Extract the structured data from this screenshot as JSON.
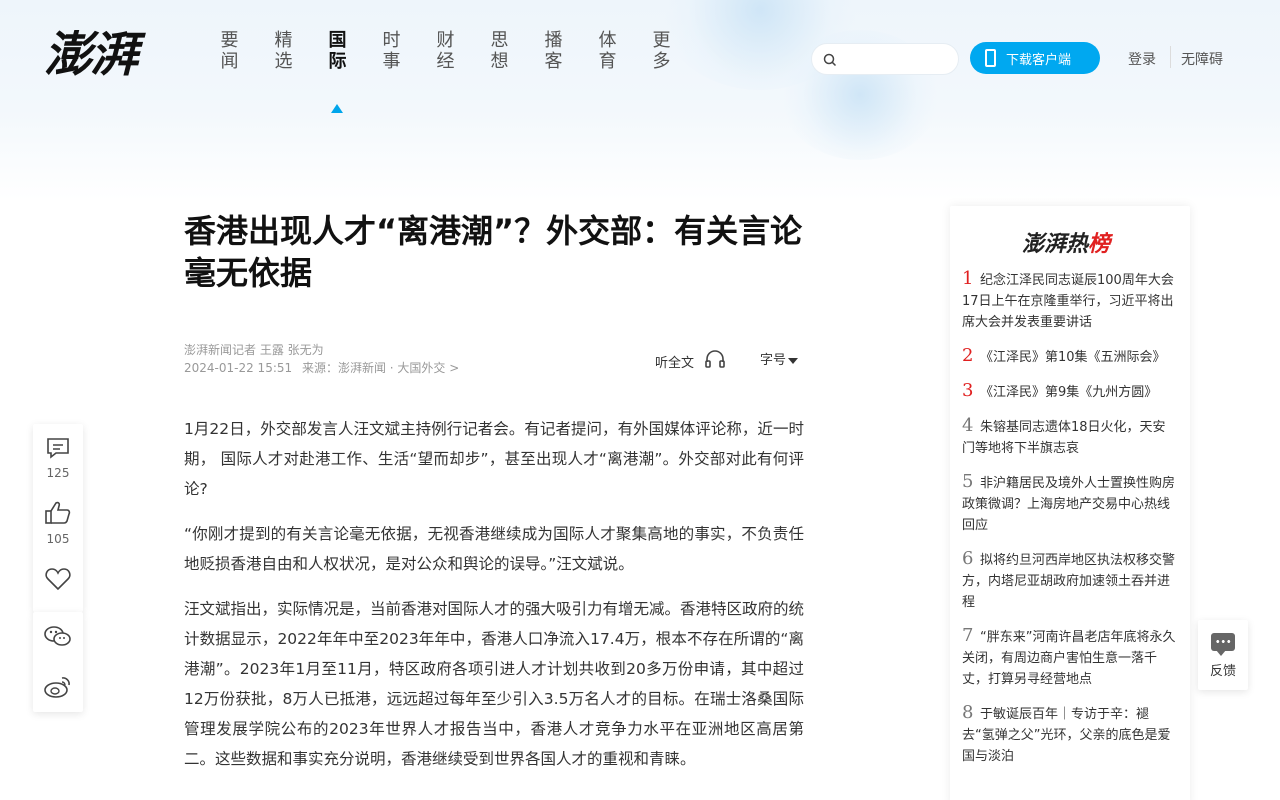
{
  "header": {
    "logo": "澎湃",
    "nav": [
      {
        "top": "要",
        "bottom": "闻",
        "active": false
      },
      {
        "top": "精",
        "bottom": "选",
        "active": false
      },
      {
        "top": "国",
        "bottom": "际",
        "active": true
      },
      {
        "top": "时",
        "bottom": "事",
        "active": false
      },
      {
        "top": "财",
        "bottom": "经",
        "active": false
      },
      {
        "top": "思",
        "bottom": "想",
        "active": false
      },
      {
        "top": "播",
        "bottom": "客",
        "active": false
      },
      {
        "top": "体",
        "bottom": "育",
        "active": false
      },
      {
        "top": "更",
        "bottom": "多",
        "active": false
      }
    ],
    "search_placeholder": "",
    "download_label": "下载客户端",
    "login_label": "登录",
    "accessibility_label": "无障碍"
  },
  "article": {
    "title": "香港出现人才“离港潮”？外交部：有关言论毫无依据",
    "authors": "澎湃新闻记者 王露 张无为",
    "datetime": "2024-01-22 15:51",
    "source_prefix": "来源：",
    "source": "澎湃新闻 · 大国外交 >",
    "listen_label": "听全文",
    "fontsize_label": "字号",
    "paragraphs": [
      "1月22日，外交部发言人汪文斌主持例行记者会。有记者提问，有外国媒体评论称，近一时期， 国际人才对赴港工作、生活“望而却步”，甚至出现人才“离港潮”。外交部对此有何评论?",
      "“你刚才提到的有关言论毫无依据，无视香港继续成为国际人才聚集高地的事实，不负责任地贬损香港自由和人权状况，是对公众和舆论的误导。”汪文斌说。",
      "汪文斌指出，实际情况是，当前香港对国际人才的强大吸引力有增无减。香港特区政府的统计数据显示，2022年年中至2023年年中，香港人口净流入17.4万，根本不存在所谓的“离港潮”。2023年1月至11月，特区政府各项引进人才计划共收到20多万份申请，其中超过12万份获批，8万人已抵港，远远超过每年至少引入3.5万名人才的目标。在瑞士洛桑国际管理发展学院公布的2023年世界人才报告当中，香港人才竞争力水平在亚洲地区高居第二。这些数据和事实充分说明，香港继续受到世界各国人才的重视和青睐。"
    ]
  },
  "share_bar": {
    "comment_count": "125",
    "like_count": "105"
  },
  "hot_list": {
    "title_main": "澎湃热",
    "title_mark": "榜",
    "items": [
      {
        "rank": "1",
        "text": "纪念江泽民同志诞辰100周年大会17日上午在京隆重举行，习近平将出席大会并发表重要讲话"
      },
      {
        "rank": "2",
        "text": "《江泽民》第10集《五洲际会》"
      },
      {
        "rank": "3",
        "text": "《江泽民》第9集《九州方圆》"
      },
      {
        "rank": "4",
        "text": "朱镕基同志遗体18日火化，天安门等地将下半旗志哀"
      },
      {
        "rank": "5",
        "text": "非沪籍居民及境外人士置换性购房政策微调？上海房地产交易中心热线回应"
      },
      {
        "rank": "6",
        "text": "拟将约旦河西岸地区执法权移交警方，内塔尼亚胡政府加速领土吞并进程"
      },
      {
        "rank": "7",
        "text": "“胖东来”河南许昌老店年底将永久关闭，有周边商户害怕生意一落千丈，打算另寻经营地点"
      },
      {
        "rank": "8",
        "text": "于敏诞辰百年｜专访于辛：褪去“氢弹之父”光环，父亲的底色是爱国与淡泊"
      }
    ]
  },
  "feedback_label": "反馈"
}
